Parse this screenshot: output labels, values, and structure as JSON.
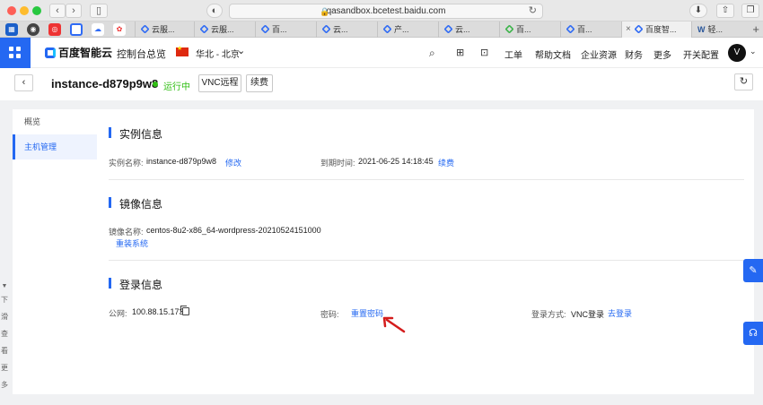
{
  "browser": {
    "url": "qasandbox.bcetest.baidu.com",
    "tabs": [
      {
        "label": "云服..."
      },
      {
        "label": "云服..."
      },
      {
        "label": "百..."
      },
      {
        "label": "云..."
      },
      {
        "label": "产..."
      },
      {
        "label": "云..."
      },
      {
        "label": "百..."
      },
      {
        "label": "百..."
      },
      {
        "label": "百度智..."
      },
      {
        "label": "轻..."
      }
    ]
  },
  "header": {
    "logo_text": "百度智能云",
    "console_overview": "控制台总览",
    "region": "华北 - 北京",
    "links": {
      "ticket": "工单",
      "docs": "帮助文档",
      "enterprise": "企业资源",
      "finance": "财务",
      "more": "更多",
      "dev_config": "开关配置"
    },
    "avatar_letter": "V"
  },
  "instance": {
    "name": "instance-d879p9w8",
    "status": "运行中",
    "vnc_button": "VNC远程",
    "renew_button": "续费"
  },
  "sidebar": {
    "items": [
      {
        "label": "概览"
      },
      {
        "label": "主机管理"
      }
    ]
  },
  "sections": {
    "instance_info": {
      "title": "实例信息",
      "name_label": "实例名称:",
      "name_value": "instance-d879p9w8",
      "edit_link": "修改",
      "expire_label": "到期时间:",
      "expire_value": "2021-06-25 14:18:45",
      "renew_link": "续费"
    },
    "image_info": {
      "title": "镜像信息",
      "image_label": "镜像名称:",
      "image_value": "centos-8u2-x86_64-wordpress-20210524151000",
      "reinstall_link": "重装系统"
    },
    "login_info": {
      "title": "登录信息",
      "ip_label": "公网:",
      "ip_value": "100.88.15.173",
      "password_label": "密码:",
      "reset_password_link": "重置密码",
      "login_method_label": "登录方式:",
      "login_method_value": "VNC登录",
      "go_login_link": "去登录"
    }
  },
  "left_edge_text": [
    "下",
    "滑",
    "查",
    "看",
    "更",
    "多"
  ],
  "colors": {
    "primary": "#2468f2",
    "running": "#30bf13",
    "arrow": "#d41c1c"
  }
}
